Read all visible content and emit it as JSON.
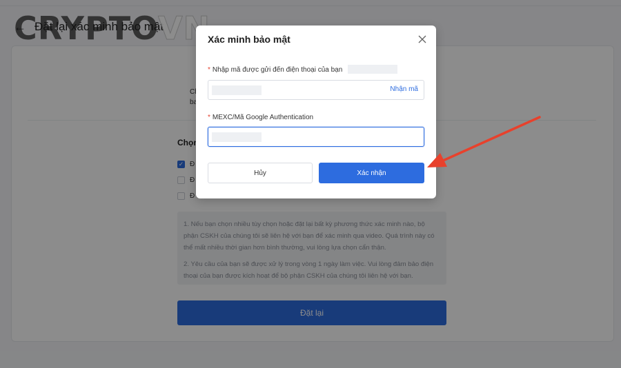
{
  "header": {
    "title": "Đặt lại xác minh bảo mật"
  },
  "watermark": {
    "part1": "CRYPTO",
    "part2": "VN"
  },
  "background": {
    "partial_line_1": "Ch",
    "partial_line_2": "ba",
    "choose_label": "Chọn",
    "options": [
      {
        "text": "Đ",
        "checked": true
      },
      {
        "text": "Đ",
        "checked": false
      },
      {
        "text": "Đ",
        "checked": false
      }
    ],
    "notice": [
      "1. Nếu bạn chọn nhiều tùy chọn hoặc đặt lại bất kỳ phương thức xác minh nào, bộ phận CSKH của chúng tôi sẽ liên hệ với bạn để xác minh qua video. Quá trình này có thể mất nhiều thời gian hơn bình thường, vui lòng lựa chọn cẩn thận.",
      "2. Yêu cầu của bạn sẽ được xử lý trong vòng 1 ngày làm việc. Vui lòng đảm bảo điện thoại của bạn được kích hoạt để bộ phận CSKH của chúng tôi liên hệ với bạn."
    ],
    "reset_button": "Đặt lại"
  },
  "modal": {
    "title": "Xác minh bảo mật",
    "field1": {
      "required_mark": "*",
      "label": "Nhập mã được gửi đến điện thoại của bạn",
      "action": "Nhận mã"
    },
    "field2": {
      "required_mark": "*",
      "label": "MEXC/Mã Google Authentication"
    },
    "cancel": "Hủy",
    "confirm": "Xác nhận"
  },
  "colors": {
    "primary": "#2d6cdf",
    "annotation_arrow": "#e8412c",
    "required": "#e5402f"
  }
}
